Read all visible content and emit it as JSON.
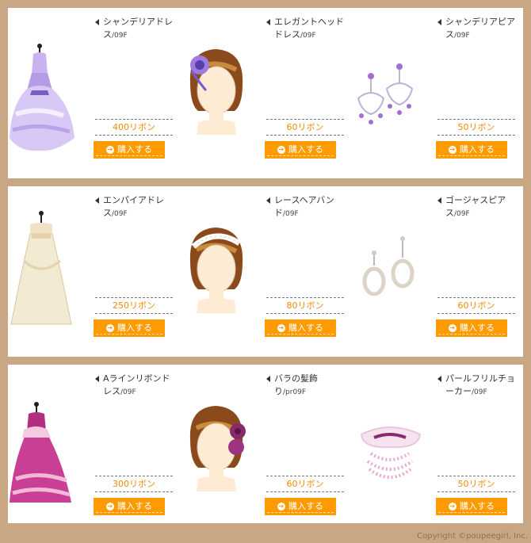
{
  "buy_label": "購入する",
  "copyright": "Copyright ©poupeegirl, Inc.",
  "colors": {
    "background": "#c8a884",
    "panel": "#ffffff",
    "price_text": "#f08c00",
    "buy_button": "#ff9a00"
  },
  "rows": [
    {
      "items": [
        {
          "name": "シャンデリアドレス",
          "code": "/09F",
          "price": "400リボン",
          "image": "lavender-ballgown-dress"
        },
        {
          "name": "エレガントヘッドドレス",
          "code": "/09F",
          "price": "60リボン",
          "image": "purple-flower-headdress"
        },
        {
          "name": "シャンデリアピアス",
          "code": "/09F",
          "price": "50リボン",
          "image": "chandelier-earrings"
        }
      ]
    },
    {
      "items": [
        {
          "name": "エンパイアドレス",
          "code": "/09F",
          "price": "250リボン",
          "image": "ivory-empire-dress"
        },
        {
          "name": "レースヘアバンド",
          "code": "/09F",
          "price": "80リボン",
          "image": "lace-hairband"
        },
        {
          "name": "ゴージャスピアス",
          "code": "/09F",
          "price": "60リボン",
          "image": "pearl-drop-earrings"
        }
      ]
    },
    {
      "items": [
        {
          "name": "Aラインリボンドレス",
          "code": "/09F",
          "price": "300リボン",
          "image": "magenta-ribbon-dress"
        },
        {
          "name": "バラの髪飾り",
          "code": "/pr09F",
          "price": "60リボン",
          "image": "rose-hair-ornament"
        },
        {
          "name": "パールフリルチョーカー",
          "code": "/09F",
          "price": "50リボン",
          "image": "pearl-frill-choker"
        }
      ]
    }
  ]
}
